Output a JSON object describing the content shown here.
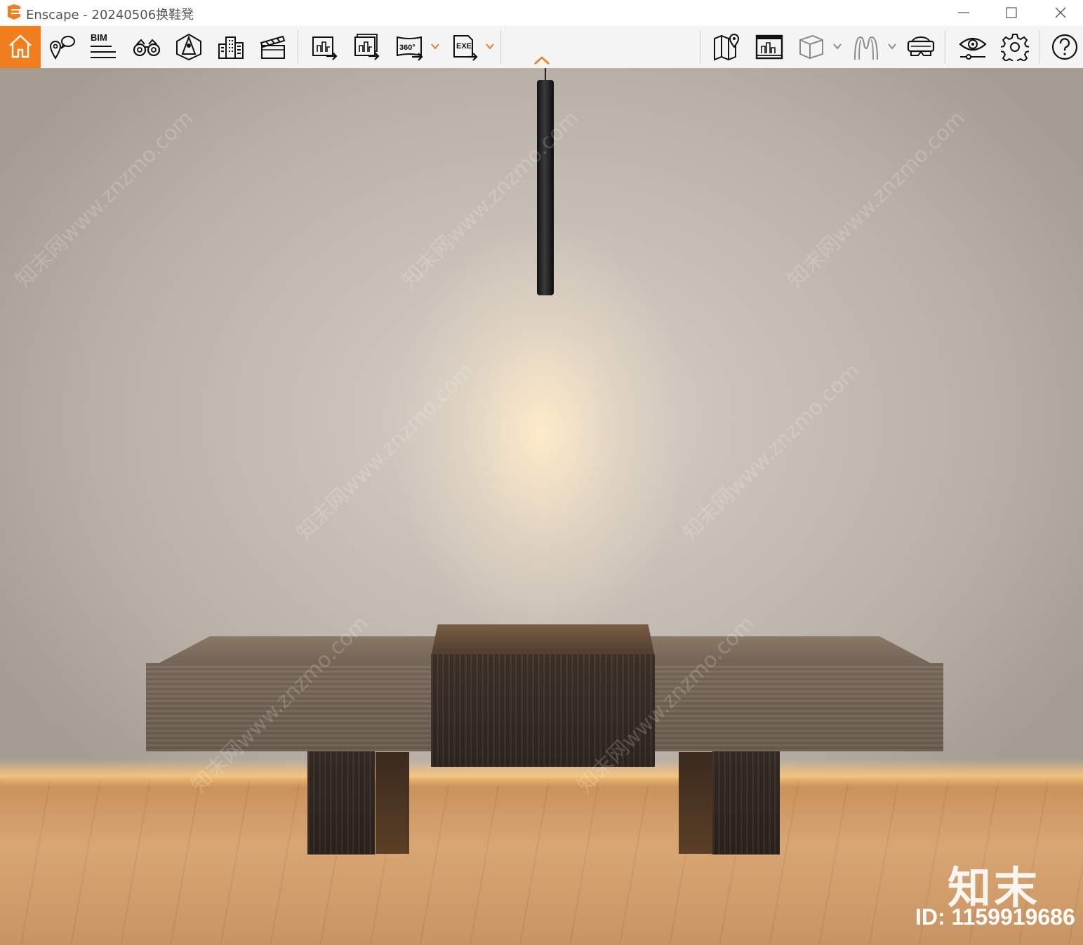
{
  "window": {
    "app_name": "Enscape",
    "title": "Enscape - 20240506换鞋凳",
    "accent_color": "#f07d1e",
    "controls": [
      "minimize-icon",
      "maximize-icon",
      "close-icon"
    ]
  },
  "toolbar": {
    "bim_label": "BIM",
    "panorama_label": "360°",
    "exe_label": "EXE",
    "left_group": [
      "home-icon",
      "location-views-icon",
      "bim-icon",
      "binoculars-icon",
      "walk-mode-icon",
      "buildings-icon",
      "clapper-icon"
    ],
    "export_group": [
      "screenshot-export-icon",
      "batch-export-icon",
      "panorama-export-icon",
      "exe-export-icon"
    ],
    "right_group": [
      "map-icon",
      "video-editor-icon",
      "cube-icon",
      "asset-library-icon",
      "vr-headset-icon",
      "visual-settings-icon",
      "gear-icon",
      "help-icon"
    ]
  },
  "viewport": {
    "watermark_text": "知末网www.znzmo.com",
    "brand_mark": "知末",
    "id_label": "ID: 1159919686"
  }
}
